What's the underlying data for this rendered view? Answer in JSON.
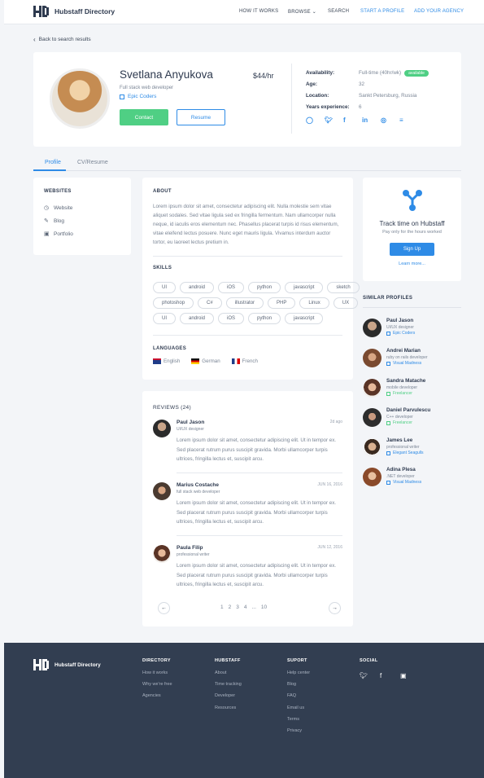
{
  "header": {
    "logo_text": "Hubstaff Directory",
    "nav": [
      "HOW IT WORKS",
      "BROWSE ⌄",
      "SEARCH",
      "START A PROFILE",
      "ADD YOUR AGENCY"
    ]
  },
  "back_link": "Back to search results",
  "profile": {
    "name": "Svetlana Anyukova",
    "role": "Full stack web developer",
    "company": "Epic Coders",
    "rate": "$44/hr",
    "contact_label": "Contact",
    "resume_label": "Resume",
    "info": [
      {
        "label": "Availability:",
        "value": "Full-time (40hr/wk)",
        "badge": "available"
      },
      {
        "label": "Age:",
        "value": "32"
      },
      {
        "label": "Location:",
        "value": "Sankt Petersburg, Russia"
      },
      {
        "label": "Years experience:",
        "value": "6"
      }
    ],
    "socials": [
      "github-icon",
      "twitter-icon",
      "facebook-icon",
      "linkedin-icon",
      "dribbble-icon",
      "stackoverflow-icon"
    ]
  },
  "tabs": [
    "Profile",
    "CV/Resume"
  ],
  "websites": {
    "title": "WEBSITES",
    "items": [
      "Website",
      "Blog",
      "Portfolio"
    ]
  },
  "about": {
    "title": "ABOUT",
    "text": "Lorem ipsum dolor sit amet, consectetur adipiscing elit. Nulla molestie sem vitae aliquet sodales. Sed vitae ligula sed ex fringilla fermentum. Nam ullamcorper nulla neque, id iaculis eros elementum nec. Phasellus placerat turpis id risus elementum, vitae eleifend lectus posuere. Nunc eget mauris ligula. Vivamus interdum auctor tortor, eu laoreet lectus pretium in."
  },
  "skills": {
    "title": "SKILLS",
    "rows": [
      [
        "UI",
        "android",
        "iOS",
        "python",
        "javascript",
        "sketch"
      ],
      [
        "photoshop",
        "C#",
        "illustrator",
        "PHP",
        "Linux",
        "UX"
      ],
      [
        "UI",
        "android",
        "iOS",
        "python",
        "javascript"
      ]
    ]
  },
  "languages": {
    "title": "LANGUAGES",
    "items": [
      "English",
      "German",
      "French"
    ]
  },
  "reviews": {
    "title": "REVIEWS (24)",
    "items": [
      {
        "name": "Paul Jason",
        "role": "UI/UX designer",
        "date": "2d ago",
        "text": "Lorem ipsum dolor sit amet, consectetur adipiscing elit. Ut in tempor ex. Sed placerat rutrum purus suscipit gravida. Morbi ullamcorper turpis ultrices, fringilla lectus et, suscipit arcu."
      },
      {
        "name": "Marius Costache",
        "role": "full stack web developer",
        "date": "JUN 16, 2016",
        "text": "Lorem ipsum dolor sit amet, consectetur adipiscing elit. Ut in tempor ex. Sed placerat rutrum purus suscipit gravida. Morbi ullamcorper turpis ultrices, fringilla lectus et, suscipit arcu."
      },
      {
        "name": "Paula Filip",
        "role": "professional writer",
        "date": "JUN 12, 2016",
        "text": "Lorem ipsum dolor sit amet, consectetur adipiscing elit. Ut in tempor ex. Sed placerat rutrum purus suscipit gravida. Morbi ullamcorper turpis ultrices, fringilla lectus et, suscipit arcu."
      }
    ],
    "pages": [
      "1",
      "2",
      "3",
      "4",
      "...",
      "10"
    ]
  },
  "track": {
    "title": "Track time on Hubstaff",
    "subtitle": "Pay only for the hours worked",
    "signup": "Sign Up",
    "learn": "Learn more..."
  },
  "similar": {
    "title": "SIMILAR PROFILES",
    "items": [
      {
        "name": "Paul Jason",
        "role": "UI/UX designer",
        "company": "Epic Coders"
      },
      {
        "name": "Andrei Marian",
        "role": "ruby on rails developer",
        "company": "Visual Madness"
      },
      {
        "name": "Sandra Matache",
        "role": "mobile developer",
        "company": "Freelancer"
      },
      {
        "name": "Daniel Parvulescu",
        "role": "C++ developer",
        "company": "Freelancer"
      },
      {
        "name": "James Lee",
        "role": "professional writer",
        "company": "Elegant Seagulls"
      },
      {
        "name": "Adina Plesa",
        "role": ".NET developer",
        "company": "Visual Madness"
      }
    ]
  },
  "footer": {
    "logo_text": "Hubstaff Directory",
    "columns": [
      {
        "title": "DIRECTORY",
        "links": [
          "How it works",
          "Why we're free",
          "Agencies"
        ]
      },
      {
        "title": "HUBSTAFF",
        "links": [
          "About",
          "Time tracking",
          "Developer",
          "Resources"
        ]
      },
      {
        "title": "SUPORT",
        "links": [
          "Help center",
          "Blog",
          "FAQ",
          "Email us",
          "Terms",
          "Privacy"
        ]
      },
      {
        "title": "SOCIAL",
        "links": []
      }
    ],
    "socials": [
      "twitter-icon",
      "facebook-icon",
      "instagram-icon"
    ]
  }
}
